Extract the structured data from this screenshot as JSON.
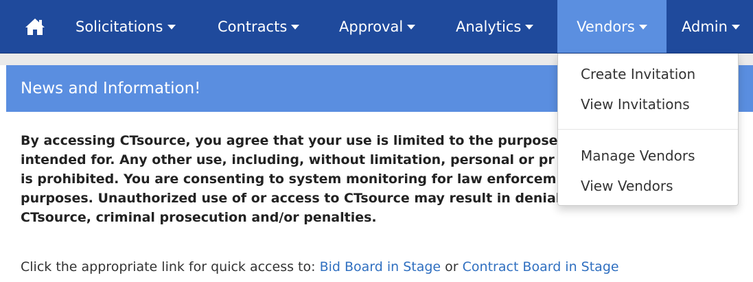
{
  "nav": {
    "home_icon": "home-icon",
    "items": [
      {
        "label": "Solicitations"
      },
      {
        "label": "Contracts"
      },
      {
        "label": "Approval"
      },
      {
        "label": "Analytics"
      },
      {
        "label": "Vendors"
      },
      {
        "label": "Admin"
      }
    ],
    "active_item": "Vendors",
    "colors": {
      "navbar": "#1f4a9c",
      "active": "#5b8fe0"
    }
  },
  "vendors_menu": {
    "items": [
      {
        "label": "Create Invitation"
      },
      {
        "label": "View Invitations"
      },
      {
        "label": "Manage Vendors"
      },
      {
        "label": "View Vendors"
      }
    ]
  },
  "panel": {
    "heading": "News and Information!",
    "heading_color": "#5a8ee0",
    "notice_line1": "By accessing CTsource, you agree that your use is limited to the purpose",
    "notice_line2": "intended for. Any other use, including, without limitation, personal or pr",
    "notice_line3": "is prohibited. You are consenting to system monitoring for law enforcem",
    "notice_line4": "purposes. Unauthorized use of or access to CTsource may result in denial of access to",
    "notice_line5": "CTsource, criminal prosecution and/or penalties.",
    "quick_text": "Click the appropriate link for quick access to:",
    "link_bid_board": "Bid Board in Stage",
    "quick_or": "or",
    "link_contract_board": "Contract Board in Stage"
  }
}
